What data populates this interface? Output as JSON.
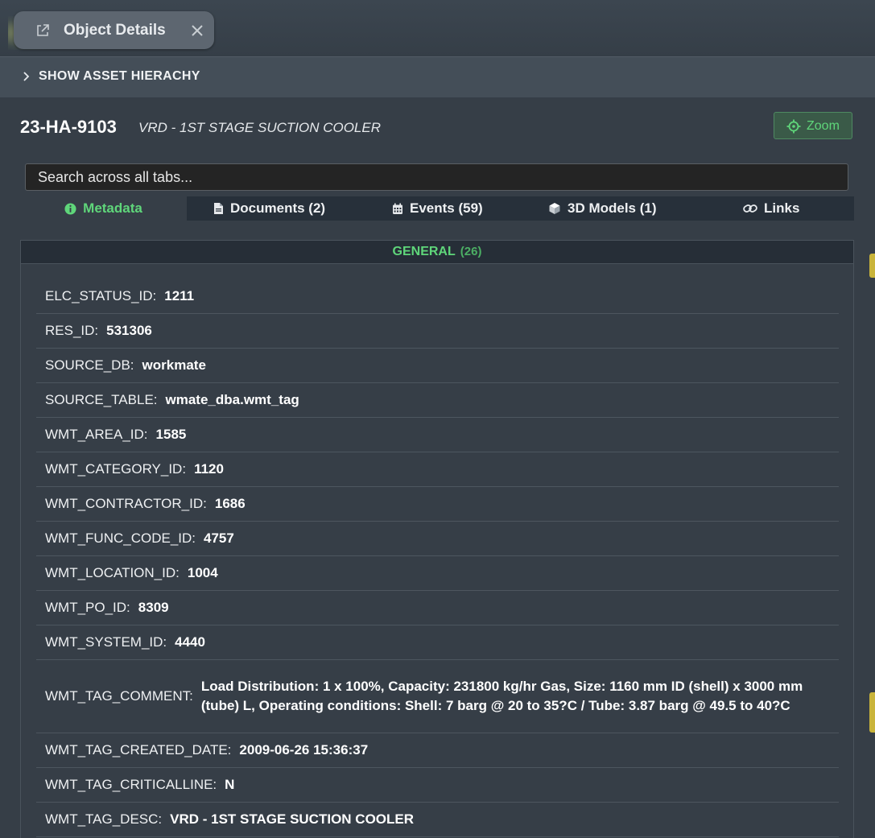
{
  "window": {
    "tab_title": "Object Details"
  },
  "hierarchy": {
    "label": "SHOW ASSET HIERACHY"
  },
  "asset": {
    "id": "23-HA-9103",
    "description": "VRD - 1ST STAGE SUCTION COOLER"
  },
  "zoom": {
    "label": "Zoom"
  },
  "search": {
    "placeholder": "Search across all tabs..."
  },
  "tabs": [
    {
      "label": "Metadata",
      "icon": "info-circle-icon",
      "active": true
    },
    {
      "label": "Documents (2)",
      "icon": "document-icon",
      "active": false
    },
    {
      "label": "Events (59)",
      "icon": "calendar-icon",
      "active": false
    },
    {
      "label": "3D Models (1)",
      "icon": "cube-icon",
      "active": false
    },
    {
      "label": "Links",
      "icon": "link-icon",
      "active": false
    }
  ],
  "section": {
    "title": "GENERAL",
    "count": "(26)"
  },
  "rows": [
    {
      "key": "ELC_STATUS_ID:",
      "value": "1211"
    },
    {
      "key": "RES_ID:",
      "value": "531306"
    },
    {
      "key": "SOURCE_DB:",
      "value": "workmate"
    },
    {
      "key": "SOURCE_TABLE:",
      "value": "wmate_dba.wmt_tag"
    },
    {
      "key": "WMT_AREA_ID:",
      "value": "1585"
    },
    {
      "key": "WMT_CATEGORY_ID:",
      "value": "1120"
    },
    {
      "key": "WMT_CONTRACTOR_ID:",
      "value": "1686"
    },
    {
      "key": "WMT_FUNC_CODE_ID:",
      "value": "4757"
    },
    {
      "key": "WMT_LOCATION_ID:",
      "value": "1004"
    },
    {
      "key": "WMT_PO_ID:",
      "value": "8309"
    },
    {
      "key": "WMT_SYSTEM_ID:",
      "value": "4440"
    },
    {
      "key": "WMT_TAG_COMMENT:",
      "value": "Load Distribution: 1 x 100%, Capacity: 231800 kg/hr Gas, Size: 1160 mm ID (shell) x 3000 mm (tube) L, Operating conditions: Shell: 7 barg @ 20 to 35?C / Tube: 3.87 barg @ 49.5 to 40?C"
    },
    {
      "key": "WMT_TAG_CREATED_DATE:",
      "value": "2009-06-26 15:36:37"
    },
    {
      "key": "WMT_TAG_CRITICALLINE:",
      "value": "N"
    },
    {
      "key": "WMT_TAG_DESC:",
      "value": "VRD - 1ST STAGE SUCTION COOLER"
    }
  ],
  "colors": {
    "accent_green": "#5fd67a",
    "panel_bg": "#363e47",
    "header_bar": "#444e58"
  }
}
